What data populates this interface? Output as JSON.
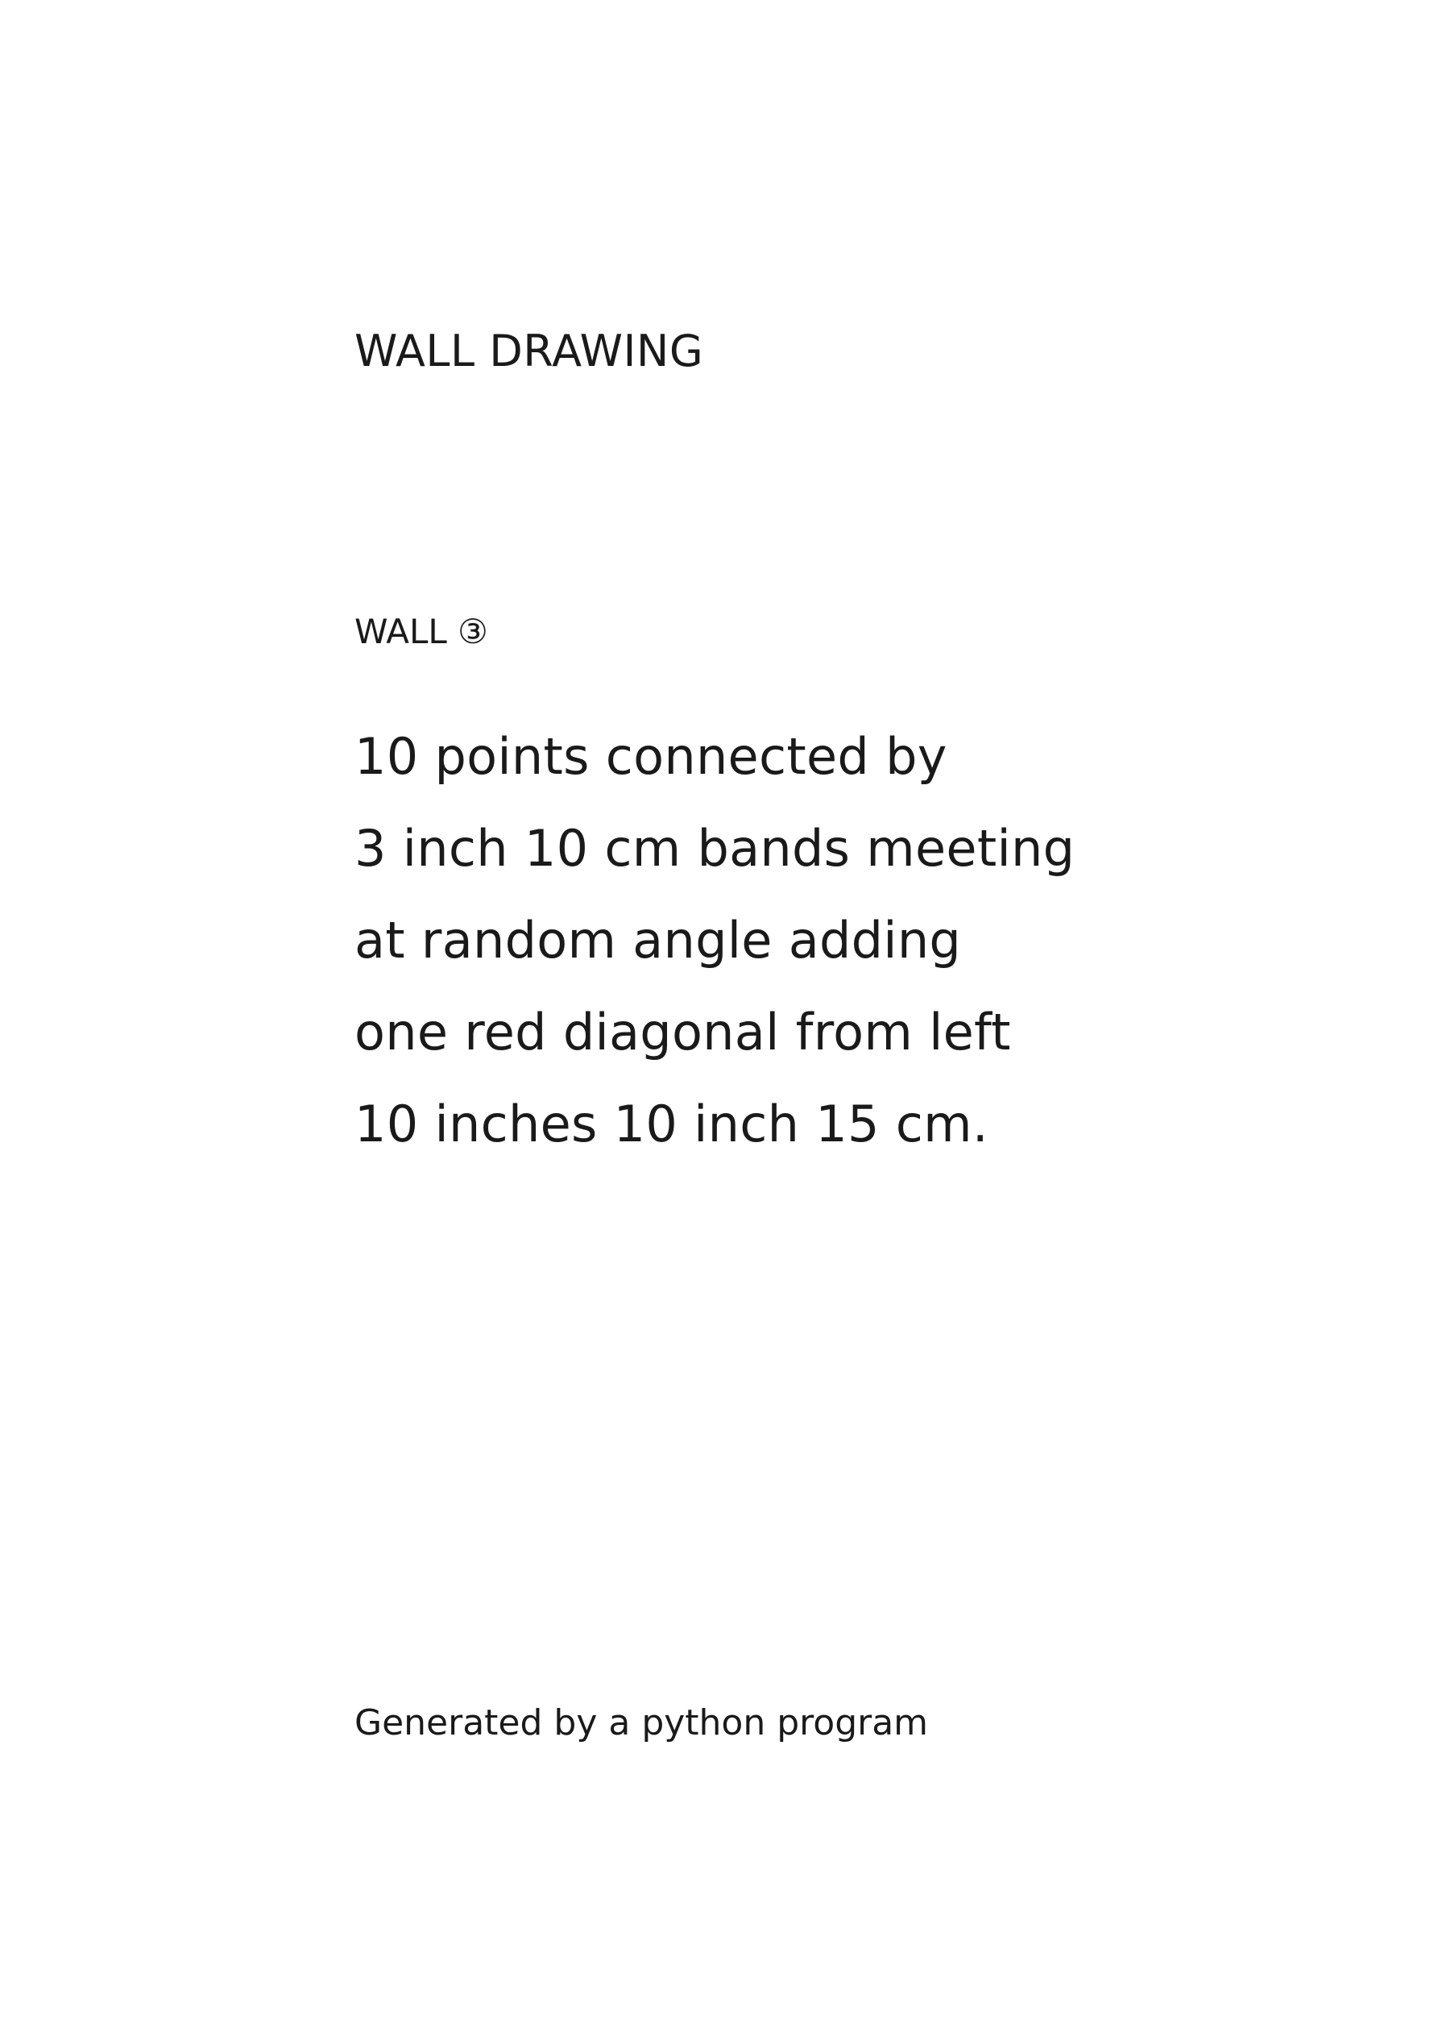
{
  "document": {
    "heading": "WALL DRAWING",
    "wall_label": "WALL ③",
    "instruction_lines": [
      "10 points connected by",
      "3 inch 10 cm bands meeting",
      "at random angle  adding",
      "one red diagonal from left",
      "10 inches 10 inch 15 cm."
    ],
    "footer_note": "Generated by a python program"
  }
}
